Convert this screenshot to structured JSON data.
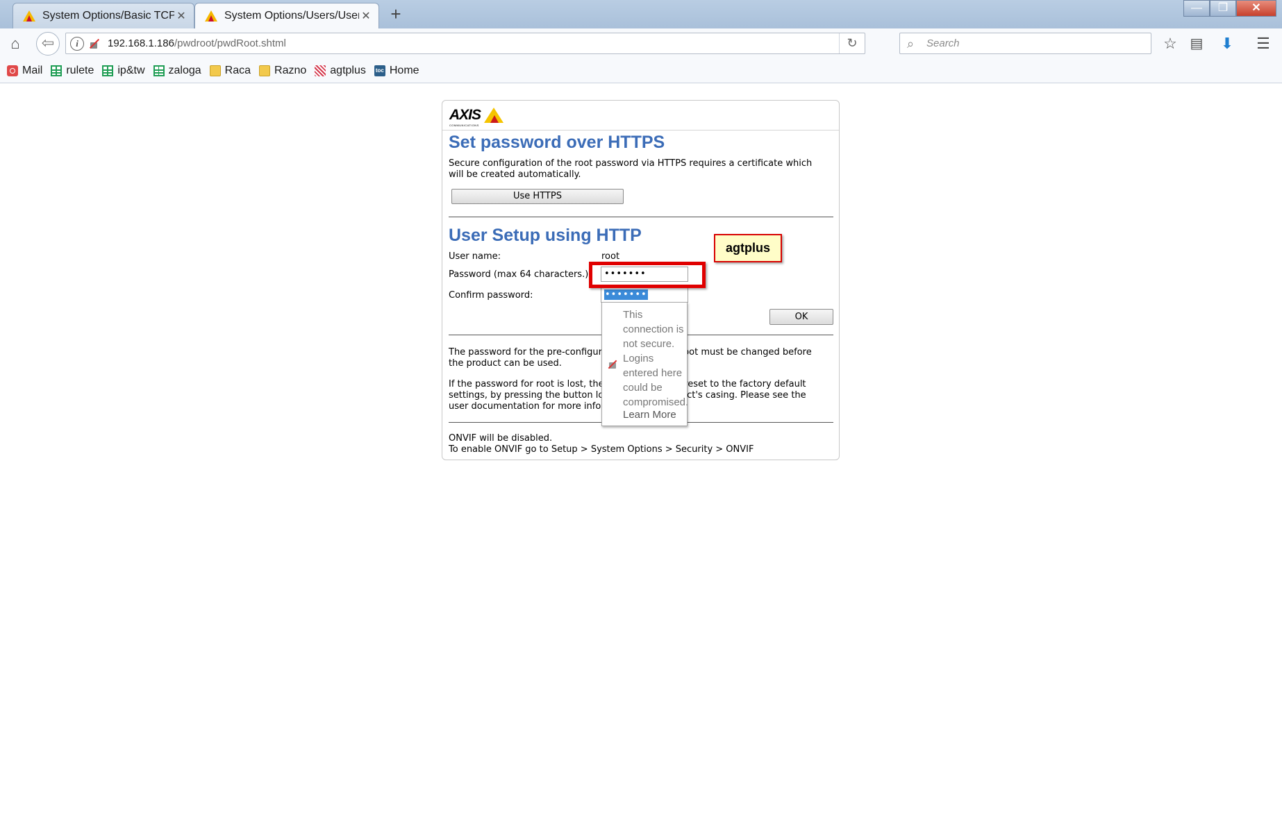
{
  "browser": {
    "tabs": [
      {
        "label": "System Options/Basic TCP/..."
      },
      {
        "label": "System Options/Users/User..."
      }
    ],
    "new_tab": "+",
    "window": {
      "minimize": "—",
      "maximize": "❐",
      "close": "✕"
    },
    "url": {
      "host": "192.168.1.186",
      "path": "/pwdroot/pwdRoot.shtml"
    },
    "search_placeholder": "Search",
    "bookmarks": [
      {
        "label": "Mail",
        "icon": "mail-icon"
      },
      {
        "label": "rulete",
        "icon": "spreadsheet-icon"
      },
      {
        "label": "ip&tw",
        "icon": "spreadsheet-icon"
      },
      {
        "label": "zaloga",
        "icon": "spreadsheet-icon"
      },
      {
        "label": "Raca",
        "icon": "folder-icon"
      },
      {
        "label": "Razno",
        "icon": "folder-icon"
      },
      {
        "label": "agtplus",
        "icon": "agtplus-icon"
      },
      {
        "label": "Home",
        "icon": "home-bookmark-icon"
      }
    ]
  },
  "page": {
    "logo": {
      "brand": "AXIS",
      "sub": "COMMUNICATIONS"
    },
    "https_section": {
      "title": "Set password over HTTPS",
      "description": "Secure configuration of the root password via HTTPS requires a certificate which will be created automatically.",
      "button": "Use HTTPS"
    },
    "http_section": {
      "title": "User Setup using HTTP",
      "username_label": "User name:",
      "username_value": "root",
      "password_label": "Password (max 64 characters.):",
      "password_value": "•••••••",
      "confirm_label": "Confirm password:",
      "confirm_value": "•••••••",
      "ok_button": "OK"
    },
    "info": {
      "p1": "The password for the pre-configured administrator root must be changed before the product can be used.",
      "p2": "If the password for root is lost, the product must be reset to the factory default settings, by pressing the button located in the product's casing. Please see the user documentation for more information.",
      "onvif1": "ONVIF will be disabled.",
      "onvif2": "To enable ONVIF go to Setup > System Options > Security > ONVIF"
    }
  },
  "annotation": {
    "note": "agtplus"
  },
  "insecure_popup": {
    "message": "This connection is not secure. Logins entered here could be compromised.",
    "link": "Learn More"
  },
  "colors": {
    "heading": "#3b6cb7",
    "annotation_border": "#e00000",
    "note_bg": "#fffdc8"
  }
}
